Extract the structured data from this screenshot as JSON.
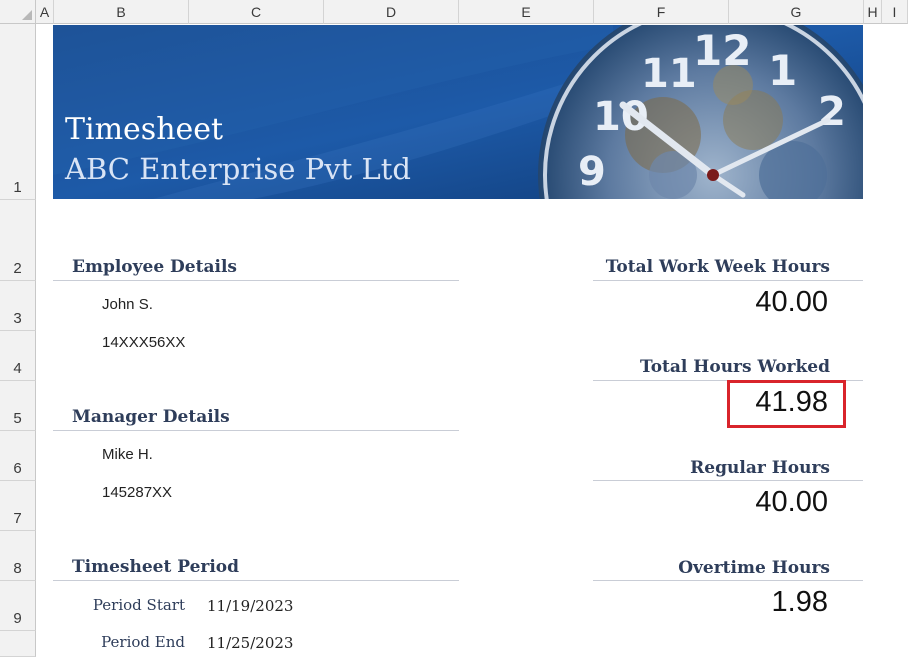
{
  "columns": [
    "A",
    "B",
    "C",
    "D",
    "E",
    "F",
    "G",
    "H",
    "I"
  ],
  "rows": [
    "1",
    "2",
    "3",
    "4",
    "5",
    "6",
    "7",
    "8",
    "9"
  ],
  "banner": {
    "title": "Timesheet",
    "subtitle": "ABC Enterprise Pvt Ltd"
  },
  "employee": {
    "heading": "Employee Details",
    "name": "John S.",
    "id": "14XXX56XX"
  },
  "manager": {
    "heading": "Manager Details",
    "name": "Mike H.",
    "id": "145287XX"
  },
  "period": {
    "heading": "Timesheet Period",
    "start_label": "Period Start",
    "start_value": "11/19/2023",
    "end_label": "Period End",
    "end_value": "11/25/2023"
  },
  "summary": {
    "work_week_label": "Total Work Week Hours",
    "work_week_value": "40.00",
    "hours_worked_label": "Total Hours Worked",
    "hours_worked_value": "41.98",
    "regular_label": "Regular Hours",
    "regular_value": "40.00",
    "overtime_label": "Overtime Hours",
    "overtime_value": "1.98"
  },
  "colors": {
    "banner_blue": "#1d4f91",
    "heading_navy": "#2e3d5a",
    "selection_red": "#d9242b"
  }
}
